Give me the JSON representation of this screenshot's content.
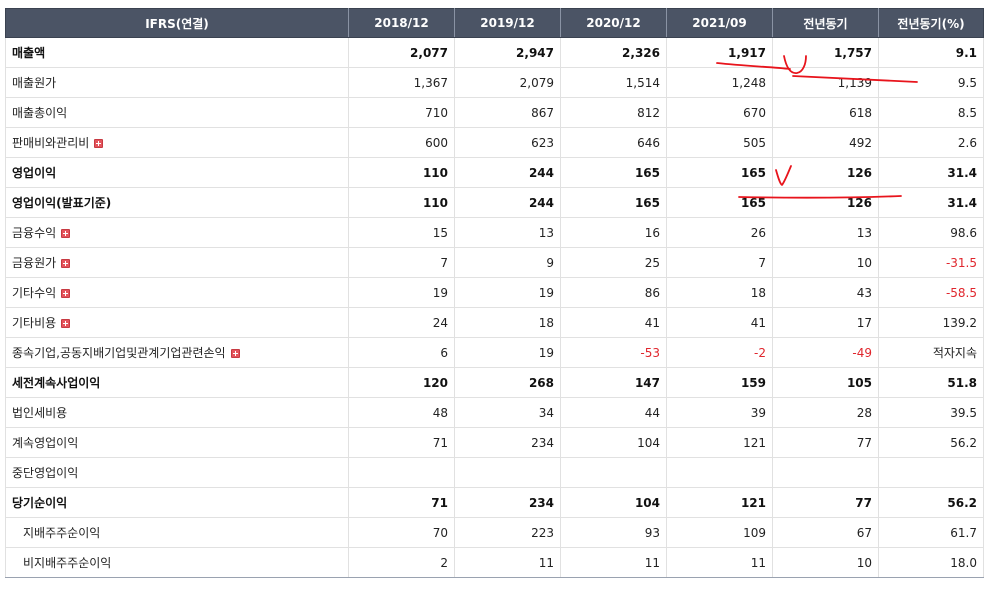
{
  "table": {
    "header": [
      "IFRS(연결)",
      "2018/12",
      "2019/12",
      "2020/12",
      "2021/09",
      "전년동기",
      "전년동기(%)"
    ],
    "rows": [
      {
        "label": "매출액",
        "bold": true,
        "expandable": false,
        "indent": false,
        "values": [
          "2,077",
          "2,947",
          "2,326",
          "1,917",
          "1,757",
          "9.1"
        ],
        "negative": []
      },
      {
        "label": "매출원가",
        "bold": false,
        "expandable": false,
        "indent": false,
        "values": [
          "1,367",
          "2,079",
          "1,514",
          "1,248",
          "1,139",
          "9.5"
        ],
        "negative": []
      },
      {
        "label": "매출총이익",
        "bold": false,
        "expandable": false,
        "indent": false,
        "values": [
          "710",
          "867",
          "812",
          "670",
          "618",
          "8.5"
        ],
        "negative": []
      },
      {
        "label": "판매비와관리비",
        "bold": false,
        "expandable": true,
        "indent": false,
        "values": [
          "600",
          "623",
          "646",
          "505",
          "492",
          "2.6"
        ],
        "negative": []
      },
      {
        "label": "영업이익",
        "bold": true,
        "expandable": false,
        "indent": false,
        "values": [
          "110",
          "244",
          "165",
          "165",
          "126",
          "31.4"
        ],
        "negative": []
      },
      {
        "label": "영업이익(발표기준)",
        "bold": true,
        "expandable": false,
        "indent": false,
        "values": [
          "110",
          "244",
          "165",
          "165",
          "126",
          "31.4"
        ],
        "negative": []
      },
      {
        "label": "금융수익",
        "bold": false,
        "expandable": true,
        "indent": false,
        "values": [
          "15",
          "13",
          "16",
          "26",
          "13",
          "98.6"
        ],
        "negative": []
      },
      {
        "label": "금융원가",
        "bold": false,
        "expandable": true,
        "indent": false,
        "values": [
          "7",
          "9",
          "25",
          "7",
          "10",
          "-31.5"
        ],
        "negative": [
          5
        ]
      },
      {
        "label": "기타수익",
        "bold": false,
        "expandable": true,
        "indent": false,
        "values": [
          "19",
          "19",
          "86",
          "18",
          "43",
          "-58.5"
        ],
        "negative": [
          5
        ]
      },
      {
        "label": "기타비용",
        "bold": false,
        "expandable": true,
        "indent": false,
        "values": [
          "24",
          "18",
          "41",
          "41",
          "17",
          "139.2"
        ],
        "negative": []
      },
      {
        "label": "종속기업,공동지배기업및관계기업관련손익",
        "bold": false,
        "expandable": true,
        "indent": false,
        "values": [
          "6",
          "19",
          "-53",
          "-2",
          "-49",
          "적자지속"
        ],
        "negative": [
          2,
          3,
          4
        ]
      },
      {
        "label": "세전계속사업이익",
        "bold": true,
        "expandable": false,
        "indent": false,
        "values": [
          "120",
          "268",
          "147",
          "159",
          "105",
          "51.8"
        ],
        "negative": []
      },
      {
        "label": "법인세비용",
        "bold": false,
        "expandable": false,
        "indent": false,
        "values": [
          "48",
          "34",
          "44",
          "39",
          "28",
          "39.5"
        ],
        "negative": []
      },
      {
        "label": "계속영업이익",
        "bold": false,
        "expandable": false,
        "indent": false,
        "values": [
          "71",
          "234",
          "104",
          "121",
          "77",
          "56.2"
        ],
        "negative": []
      },
      {
        "label": "중단영업이익",
        "bold": false,
        "expandable": false,
        "indent": false,
        "values": [
          "",
          "",
          "",
          "",
          "",
          ""
        ],
        "negative": []
      },
      {
        "label": "당기순이익",
        "bold": true,
        "expandable": false,
        "indent": false,
        "values": [
          "71",
          "234",
          "104",
          "121",
          "77",
          "56.2"
        ],
        "negative": []
      },
      {
        "label": "지배주주순이익",
        "bold": false,
        "expandable": false,
        "indent": true,
        "values": [
          "70",
          "223",
          "93",
          "109",
          "67",
          "61.7"
        ],
        "negative": []
      },
      {
        "label": "비지배주주순이익",
        "bold": false,
        "expandable": false,
        "indent": true,
        "values": [
          "2",
          "11",
          "11",
          "11",
          "10",
          "18.0"
        ],
        "negative": []
      }
    ]
  },
  "colors": {
    "header_bg": "#4b5465",
    "negative_text": "#e0262d",
    "annotation_ink": "#e8141c",
    "expand_icon": "#e4545c"
  }
}
